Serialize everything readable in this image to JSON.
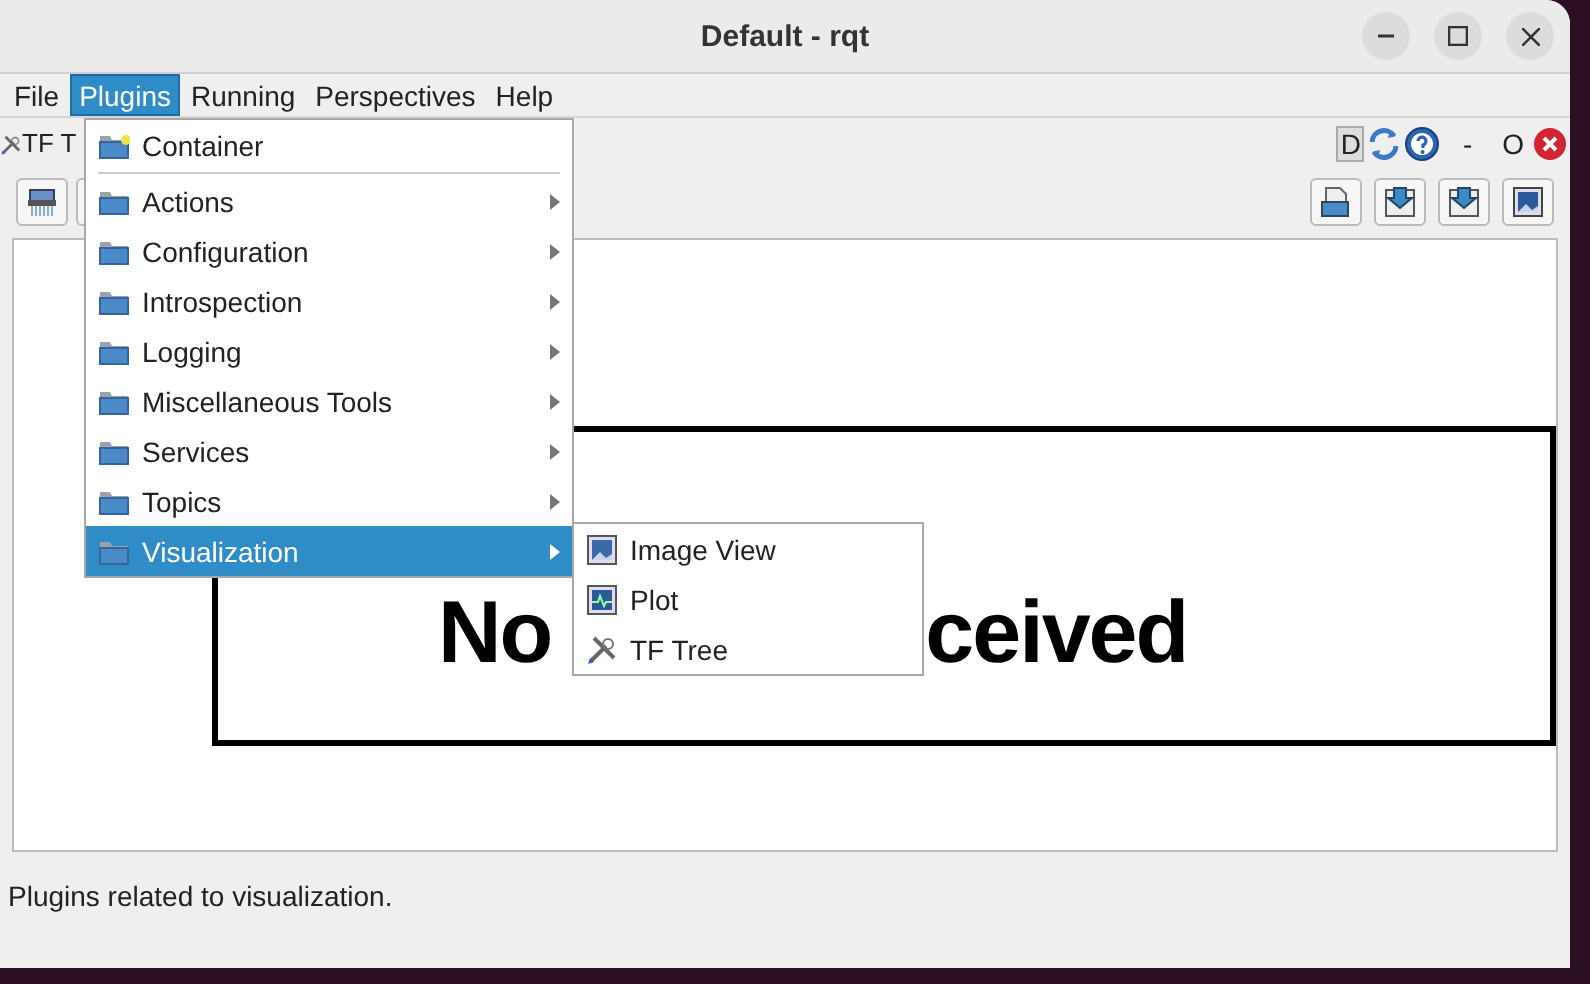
{
  "window": {
    "title": "Default - rqt"
  },
  "menubar": [
    {
      "label": "File",
      "selected": false
    },
    {
      "label": "Plugins",
      "selected": true
    },
    {
      "label": "Running",
      "selected": false
    },
    {
      "label": "Perspectives",
      "selected": false
    },
    {
      "label": "Help",
      "selected": false
    }
  ],
  "plugin_bar": {
    "title": "TF T",
    "controls": [
      {
        "kind": "toggle",
        "label": "D"
      },
      {
        "kind": "reload"
      },
      {
        "kind": "help"
      },
      {
        "kind": "text",
        "label": "-"
      },
      {
        "kind": "text",
        "label": "O"
      },
      {
        "kind": "close"
      }
    ]
  },
  "toolbar": {
    "left": [
      {
        "kind": "shredder"
      },
      {
        "kind": "blank"
      }
    ],
    "right": [
      {
        "kind": "open"
      },
      {
        "kind": "load"
      },
      {
        "kind": "save"
      },
      {
        "kind": "image"
      }
    ]
  },
  "canvas": {
    "texts": [
      "No",
      "ceived"
    ]
  },
  "plugins_menu": [
    {
      "label": "Container",
      "kind": "container",
      "submenu": false,
      "selected": false
    },
    {
      "kind": "separator"
    },
    {
      "label": "Actions",
      "kind": "folder",
      "submenu": true,
      "selected": false
    },
    {
      "label": "Configuration",
      "kind": "folder",
      "submenu": true,
      "selected": false
    },
    {
      "label": "Introspection",
      "kind": "folder",
      "submenu": true,
      "selected": false
    },
    {
      "label": "Logging",
      "kind": "folder",
      "submenu": true,
      "selected": false
    },
    {
      "label": "Miscellaneous Tools",
      "kind": "folder",
      "submenu": true,
      "selected": false
    },
    {
      "label": "Services",
      "kind": "folder",
      "submenu": true,
      "selected": false
    },
    {
      "label": "Topics",
      "kind": "folder",
      "submenu": true,
      "selected": false
    },
    {
      "label": "Visualization",
      "kind": "folder",
      "submenu": true,
      "selected": true
    }
  ],
  "submenu": [
    {
      "label": "Image View",
      "kind": "image",
      "selected": false
    },
    {
      "label": "Plot",
      "kind": "plot",
      "selected": false
    },
    {
      "label": "TF Tree",
      "kind": "tools",
      "selected": false
    }
  ],
  "status_bar": {
    "text": "Plugins related to visualization."
  }
}
